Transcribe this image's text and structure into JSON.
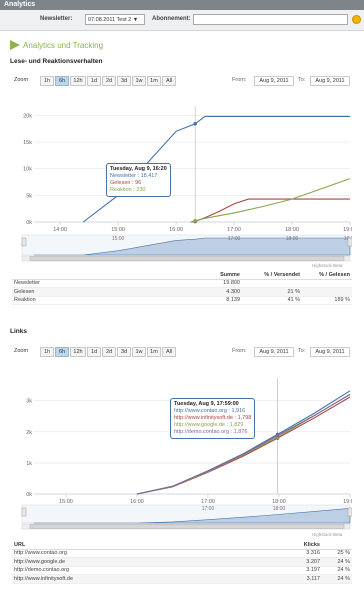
{
  "window": {
    "title": "Analytics"
  },
  "toolbar": {
    "newsletter_label": "Newsletter:",
    "newsletter_value": "07.08.2011 Test 2 ▼",
    "subscription_label": "Abonnement:",
    "subscription_value": ""
  },
  "page_heading": "Analytics und Tracking",
  "section_reading": {
    "title": "Lese- und Reaktionsverhalten",
    "zoom_label": "Zoom",
    "zoom_buttons": [
      "1h",
      "6h",
      "12h",
      "1d",
      "2d",
      "3d",
      "1w",
      "1m",
      "All"
    ],
    "zoom_selected": "6h",
    "from_label": "From:",
    "from_value": "Aug 9, 2011",
    "to_label": "To:",
    "to_value": "Aug 9, 2011",
    "credit": "Highstock Beta",
    "tooltip": {
      "title": "Tuesday, Aug 9, 16:20",
      "lines": [
        {
          "label": "Newsletter : 18,417",
          "color": "#4572a7"
        },
        {
          "label": "Gelesen : 96",
          "color": "#aa4643"
        },
        {
          "label": "Reaktion : 230",
          "color": "#89a54e"
        }
      ]
    },
    "table": {
      "headers": [
        "",
        "Summe",
        "% / Versendet",
        "% / Gelesen"
      ],
      "rows": [
        [
          "Newsletter",
          "19.800",
          "",
          ""
        ],
        [
          "Gelesen",
          "4.300",
          "21 %",
          ""
        ],
        [
          "Reaktion",
          "8.139",
          "41 %",
          "189 %"
        ]
      ]
    }
  },
  "section_links": {
    "title": "Links",
    "zoom_label": "Zoom",
    "zoom_buttons": [
      "1h",
      "6h",
      "12h",
      "1d",
      "2d",
      "3d",
      "1w",
      "1m",
      "All"
    ],
    "zoom_selected": "6h",
    "from_label": "From:",
    "from_value": "Aug 9, 2011",
    "to_label": "To:",
    "to_value": "Aug 9, 2011",
    "credit": "Highstock Beta",
    "tooltip": {
      "title": "Tuesday, Aug 9, 17:59:00",
      "lines": [
        {
          "label": "http://www.contao.org : 1,916",
          "color": "#4572a7"
        },
        {
          "label": "http://www.infinitysoft.de : 1,798",
          "color": "#aa4643"
        },
        {
          "label": "http://www.google.de : 1,829",
          "color": "#89a54e"
        },
        {
          "label": "http://demo.contao.org : 1,876",
          "color": "#80699b"
        }
      ]
    },
    "table": {
      "headers": [
        "URL",
        "Klicks",
        ""
      ],
      "rows": [
        [
          "http://www.contao.org",
          "3.316",
          "25 %"
        ],
        [
          "http://www.google.de",
          "3.207",
          "24 %"
        ],
        [
          "http://demo.contao.org",
          "3.197",
          "24 %"
        ],
        [
          "http://www.infinitysoft.de",
          "3.117",
          "24 %"
        ]
      ]
    }
  },
  "chart_data": [
    {
      "type": "line",
      "xlabel": "",
      "ylabel": "",
      "x_ticks": [
        "14:00",
        "15:00",
        "16:00",
        "17:00",
        "18:00",
        "19:00"
      ],
      "y_ticks": [
        "0k",
        "5k",
        "10k",
        "15k",
        "20k"
      ],
      "xlim": [
        13.55,
        19.0
      ],
      "ylim": [
        0,
        21000
      ],
      "navigator_ticks": [
        "15:00",
        "17:00",
        "18:00",
        "19:00"
      ],
      "series": [
        {
          "name": "Newsletter",
          "color": "#4572a7",
          "x": [
            14.4,
            15.0,
            15.5,
            16.0,
            16.33,
            16.5,
            17.0,
            18.0,
            19.0
          ],
          "values": [
            0,
            5000,
            11000,
            17000,
            18417,
            19800,
            19800,
            19800,
            19800
          ]
        },
        {
          "name": "Gelesen",
          "color": "#aa4643",
          "x": [
            16.25,
            16.33,
            16.5,
            16.75,
            17.0,
            17.25,
            17.5,
            18.0,
            19.0
          ],
          "values": [
            0,
            96,
            800,
            2000,
            3400,
            4300,
            4300,
            4300,
            4300
          ]
        },
        {
          "name": "Reaktion",
          "color": "#89a54e",
          "x": [
            16.25,
            16.33,
            16.5,
            17.0,
            17.5,
            18.0,
            18.5,
            19.0
          ],
          "values": [
            0,
            230,
            700,
            1700,
            2900,
            4300,
            6200,
            8139
          ]
        }
      ]
    },
    {
      "type": "line",
      "xlabel": "",
      "ylabel": "",
      "x_ticks": [
        "15:00",
        "16:00",
        "17:00",
        "18:00",
        "19:00"
      ],
      "y_ticks": [
        "0k",
        "1k",
        "2k",
        "3k"
      ],
      "xlim": [
        14.55,
        19.0
      ],
      "ylim": [
        0,
        3600
      ],
      "navigator_ticks": [
        "17:00",
        "18:00"
      ],
      "series": [
        {
          "name": "http://www.contao.org",
          "color": "#4572a7",
          "x": [
            16.0,
            16.5,
            17.0,
            17.5,
            17.98,
            18.5,
            19.0
          ],
          "values": [
            0,
            250,
            750,
            1300,
            1916,
            2600,
            3316
          ]
        },
        {
          "name": "http://www.infinitysoft.de",
          "color": "#aa4643",
          "x": [
            16.0,
            16.5,
            17.0,
            17.5,
            17.98,
            18.5,
            19.0
          ],
          "values": [
            0,
            230,
            700,
            1220,
            1798,
            2450,
            3117
          ]
        },
        {
          "name": "http://www.google.de",
          "color": "#89a54e",
          "x": [
            16.0,
            16.5,
            17.0,
            17.5,
            17.98,
            18.5,
            19.0
          ],
          "values": [
            0,
            240,
            720,
            1260,
            1829,
            2520,
            3207
          ]
        },
        {
          "name": "http://demo.contao.org",
          "color": "#80699b",
          "x": [
            16.0,
            16.5,
            17.0,
            17.5,
            17.98,
            18.5,
            19.0
          ],
          "values": [
            0,
            245,
            735,
            1280,
            1876,
            2530,
            3197
          ]
        }
      ]
    }
  ]
}
